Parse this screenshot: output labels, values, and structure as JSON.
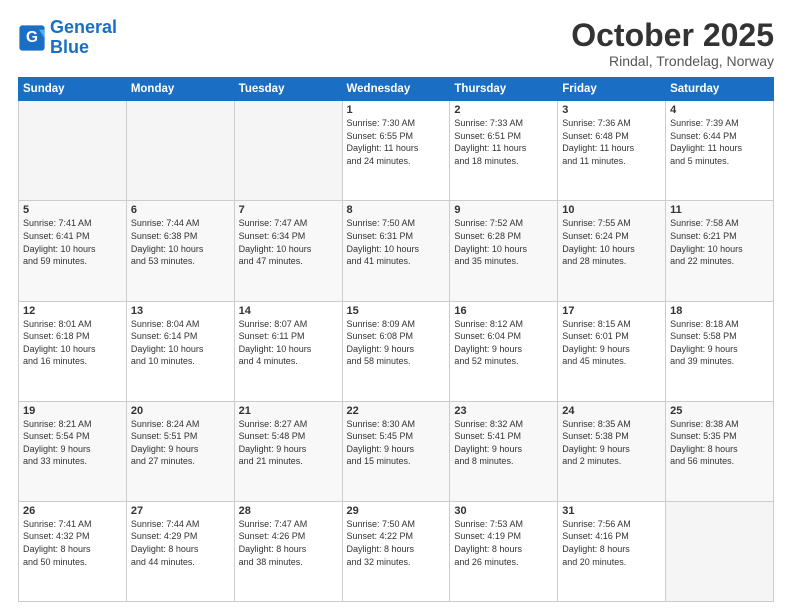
{
  "header": {
    "logo_line1": "General",
    "logo_line2": "Blue",
    "title": "October 2025",
    "subtitle": "Rindal, Trondelag, Norway"
  },
  "days_of_week": [
    "Sunday",
    "Monday",
    "Tuesday",
    "Wednesday",
    "Thursday",
    "Friday",
    "Saturday"
  ],
  "weeks": [
    [
      {
        "day": "",
        "content": ""
      },
      {
        "day": "",
        "content": ""
      },
      {
        "day": "",
        "content": ""
      },
      {
        "day": "1",
        "content": "Sunrise: 7:30 AM\nSunset: 6:55 PM\nDaylight: 11 hours\nand 24 minutes."
      },
      {
        "day": "2",
        "content": "Sunrise: 7:33 AM\nSunset: 6:51 PM\nDaylight: 11 hours\nand 18 minutes."
      },
      {
        "day": "3",
        "content": "Sunrise: 7:36 AM\nSunset: 6:48 PM\nDaylight: 11 hours\nand 11 minutes."
      },
      {
        "day": "4",
        "content": "Sunrise: 7:39 AM\nSunset: 6:44 PM\nDaylight: 11 hours\nand 5 minutes."
      }
    ],
    [
      {
        "day": "5",
        "content": "Sunrise: 7:41 AM\nSunset: 6:41 PM\nDaylight: 10 hours\nand 59 minutes."
      },
      {
        "day": "6",
        "content": "Sunrise: 7:44 AM\nSunset: 6:38 PM\nDaylight: 10 hours\nand 53 minutes."
      },
      {
        "day": "7",
        "content": "Sunrise: 7:47 AM\nSunset: 6:34 PM\nDaylight: 10 hours\nand 47 minutes."
      },
      {
        "day": "8",
        "content": "Sunrise: 7:50 AM\nSunset: 6:31 PM\nDaylight: 10 hours\nand 41 minutes."
      },
      {
        "day": "9",
        "content": "Sunrise: 7:52 AM\nSunset: 6:28 PM\nDaylight: 10 hours\nand 35 minutes."
      },
      {
        "day": "10",
        "content": "Sunrise: 7:55 AM\nSunset: 6:24 PM\nDaylight: 10 hours\nand 28 minutes."
      },
      {
        "day": "11",
        "content": "Sunrise: 7:58 AM\nSunset: 6:21 PM\nDaylight: 10 hours\nand 22 minutes."
      }
    ],
    [
      {
        "day": "12",
        "content": "Sunrise: 8:01 AM\nSunset: 6:18 PM\nDaylight: 10 hours\nand 16 minutes."
      },
      {
        "day": "13",
        "content": "Sunrise: 8:04 AM\nSunset: 6:14 PM\nDaylight: 10 hours\nand 10 minutes."
      },
      {
        "day": "14",
        "content": "Sunrise: 8:07 AM\nSunset: 6:11 PM\nDaylight: 10 hours\nand 4 minutes."
      },
      {
        "day": "15",
        "content": "Sunrise: 8:09 AM\nSunset: 6:08 PM\nDaylight: 9 hours\nand 58 minutes."
      },
      {
        "day": "16",
        "content": "Sunrise: 8:12 AM\nSunset: 6:04 PM\nDaylight: 9 hours\nand 52 minutes."
      },
      {
        "day": "17",
        "content": "Sunrise: 8:15 AM\nSunset: 6:01 PM\nDaylight: 9 hours\nand 45 minutes."
      },
      {
        "day": "18",
        "content": "Sunrise: 8:18 AM\nSunset: 5:58 PM\nDaylight: 9 hours\nand 39 minutes."
      }
    ],
    [
      {
        "day": "19",
        "content": "Sunrise: 8:21 AM\nSunset: 5:54 PM\nDaylight: 9 hours\nand 33 minutes."
      },
      {
        "day": "20",
        "content": "Sunrise: 8:24 AM\nSunset: 5:51 PM\nDaylight: 9 hours\nand 27 minutes."
      },
      {
        "day": "21",
        "content": "Sunrise: 8:27 AM\nSunset: 5:48 PM\nDaylight: 9 hours\nand 21 minutes."
      },
      {
        "day": "22",
        "content": "Sunrise: 8:30 AM\nSunset: 5:45 PM\nDaylight: 9 hours\nand 15 minutes."
      },
      {
        "day": "23",
        "content": "Sunrise: 8:32 AM\nSunset: 5:41 PM\nDaylight: 9 hours\nand 8 minutes."
      },
      {
        "day": "24",
        "content": "Sunrise: 8:35 AM\nSunset: 5:38 PM\nDaylight: 9 hours\nand 2 minutes."
      },
      {
        "day": "25",
        "content": "Sunrise: 8:38 AM\nSunset: 5:35 PM\nDaylight: 8 hours\nand 56 minutes."
      }
    ],
    [
      {
        "day": "26",
        "content": "Sunrise: 7:41 AM\nSunset: 4:32 PM\nDaylight: 8 hours\nand 50 minutes."
      },
      {
        "day": "27",
        "content": "Sunrise: 7:44 AM\nSunset: 4:29 PM\nDaylight: 8 hours\nand 44 minutes."
      },
      {
        "day": "28",
        "content": "Sunrise: 7:47 AM\nSunset: 4:26 PM\nDaylight: 8 hours\nand 38 minutes."
      },
      {
        "day": "29",
        "content": "Sunrise: 7:50 AM\nSunset: 4:22 PM\nDaylight: 8 hours\nand 32 minutes."
      },
      {
        "day": "30",
        "content": "Sunrise: 7:53 AM\nSunset: 4:19 PM\nDaylight: 8 hours\nand 26 minutes."
      },
      {
        "day": "31",
        "content": "Sunrise: 7:56 AM\nSunset: 4:16 PM\nDaylight: 8 hours\nand 20 minutes."
      },
      {
        "day": "",
        "content": ""
      }
    ]
  ]
}
